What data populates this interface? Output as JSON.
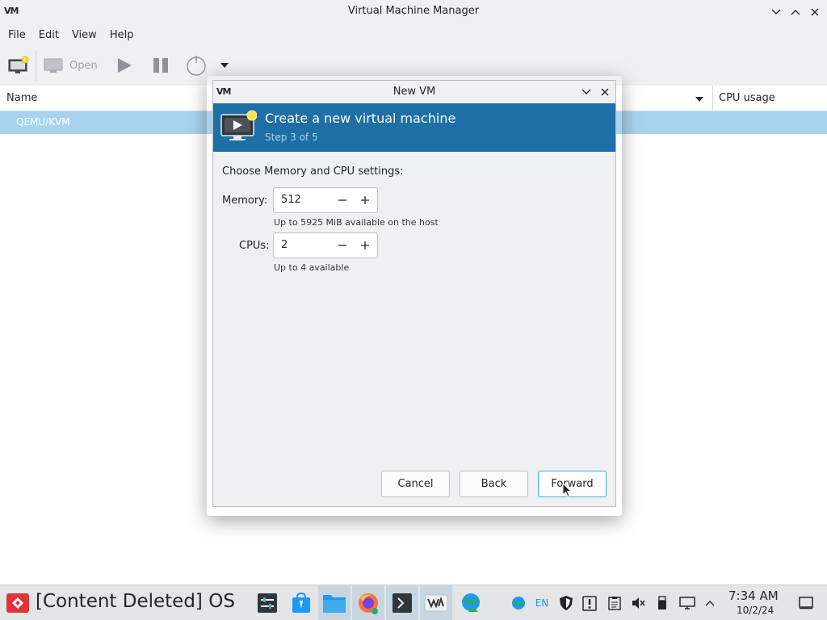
{
  "window": {
    "logo": "VM",
    "title": "Virtual Machine Manager"
  },
  "menu": [
    "File",
    "Edit",
    "View",
    "Help"
  ],
  "toolbar": {
    "open_label": "Open"
  },
  "list": {
    "col_name": "Name",
    "col_cpu": "CPU usage",
    "rows": [
      "QEMU/KVM"
    ]
  },
  "dialog": {
    "logo": "VM",
    "title": "New VM",
    "banner_title": "Create a new virtual machine",
    "banner_step": "Step 3 of 5",
    "section_label": "Choose Memory and CPU settings:",
    "memory_label": "Memory:",
    "memory_value": "512",
    "memory_hint": "Up to 5925 MiB available on the host",
    "cpus_label": "CPUs:",
    "cpus_value": "2",
    "cpus_hint": "Up to 4 available",
    "cancel_label": "Cancel",
    "back_label": "Back",
    "forward_label": "Forward"
  },
  "taskbar": {
    "os_label": "[Content Deleted] OS",
    "apps": [
      "settings-app-icon",
      "store-app-icon",
      "files-app-icon",
      "firefox-app-icon",
      "terminal-app-icon",
      "vm-app-icon",
      "network-app-icon"
    ],
    "tray_lang": "EN",
    "clock_time": "7:34 AM",
    "clock_date": "10/2/24"
  },
  "colors": {
    "banner": "#1e6fa6",
    "selection": "#a8d3ef",
    "accent": "#3daee9",
    "start": "#e0333a"
  }
}
